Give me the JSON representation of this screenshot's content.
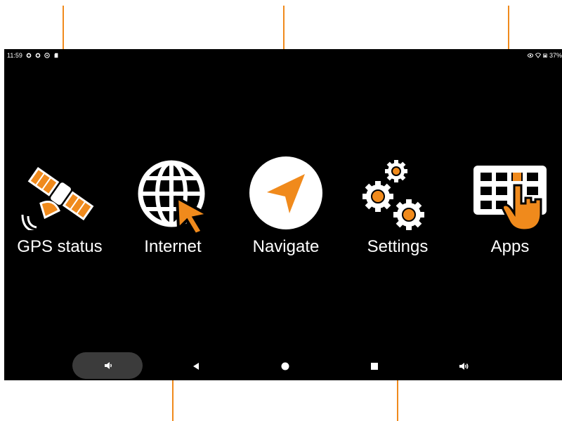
{
  "status_bar": {
    "time": "11:59",
    "battery": "37%",
    "left_icons": [
      "gear-icon",
      "gear-icon",
      "settings-circle-icon",
      "sd-card-icon"
    ],
    "right_icons": [
      "eye-icon",
      "wifi-icon",
      "battery-icon"
    ]
  },
  "apps": [
    {
      "label": "GPS status",
      "icon": "satellite-icon"
    },
    {
      "label": "Internet",
      "icon": "globe-cursor-icon"
    },
    {
      "label": "Navigate",
      "icon": "navigation-arrow-icon"
    },
    {
      "label": "Settings",
      "icon": "gears-icon"
    },
    {
      "label": "Apps",
      "icon": "app-grid-hand-icon"
    }
  ],
  "navigation_bar": {
    "items": [
      "volume-down-icon",
      "back-icon",
      "home-icon",
      "recents-icon",
      "volume-up-icon"
    ]
  },
  "colors": {
    "accent": "#f08a1c",
    "screen_background": "#000000",
    "text": "#ffffff",
    "pill": "#3b3b3b"
  }
}
